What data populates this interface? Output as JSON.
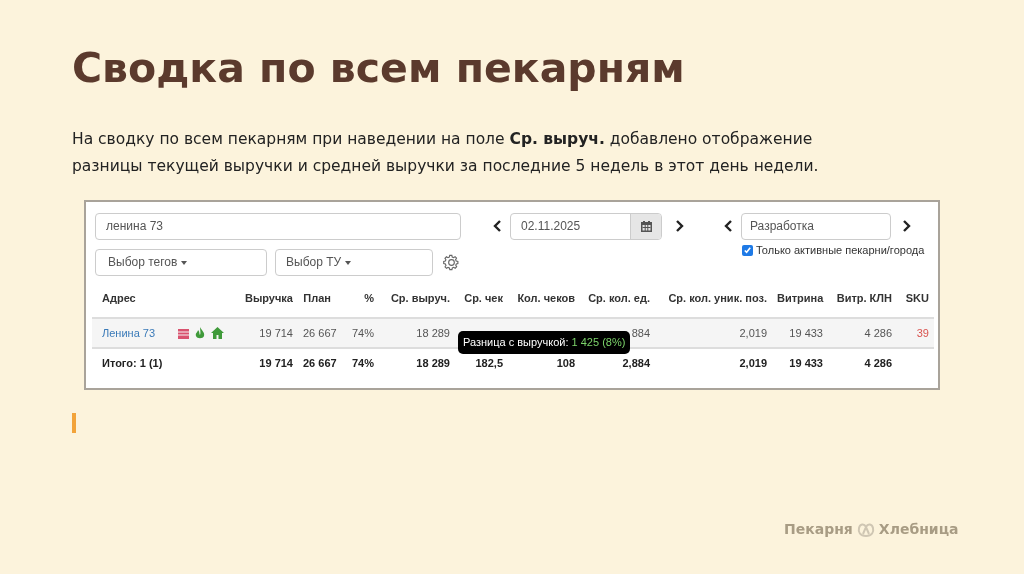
{
  "slide": {
    "title": "Сводка по всем пекарням",
    "text": "На сводку по всем пекарням при наведении на поле **Ср. выруч.** добавлено отображение разницы текущей выручки и средней выручки за последние 5 недель в этот день недели."
  },
  "filters": {
    "search": {
      "value": "ленина 73"
    },
    "date": {
      "value": "02.11.2025"
    },
    "group": {
      "value": "Разработка"
    },
    "tags_dropdown": "Выбор тегов",
    "tu_dropdown": "Выбор ТУ",
    "active_only": {
      "label": "Только активные пекарни/города",
      "checked": true
    }
  },
  "table": {
    "columns": [
      "Адрес",
      "Выручка",
      "План",
      "%",
      "Ср. выруч.",
      "Ср. чек",
      "Кол. чеков",
      "Ср. кол. ед.",
      "Ср. кол. уник. поз.",
      "Витрина",
      "Витр. КЛН",
      "SKU"
    ],
    "rows": [
      {
        "kind": "data",
        "cells": [
          "Ленина 73",
          "19 714",
          "26 667",
          "74%",
          "18 289",
          null,
          null,
          "884",
          "2,019",
          "19 433",
          "4 286",
          "39"
        ]
      },
      {
        "kind": "total",
        "cells": [
          "Итого: 1 (1)",
          "19 714",
          "26 667",
          "74%",
          "18 289",
          "182,5",
          "108",
          "2,884",
          "2,019",
          "19 433",
          "4 286"
        ]
      }
    ],
    "tooltip": {
      "label": "Разница с выручкой:",
      "value": "1 425 (8%)"
    }
  },
  "logo": {
    "left": "Пекарня",
    "right": "Хлебница"
  }
}
